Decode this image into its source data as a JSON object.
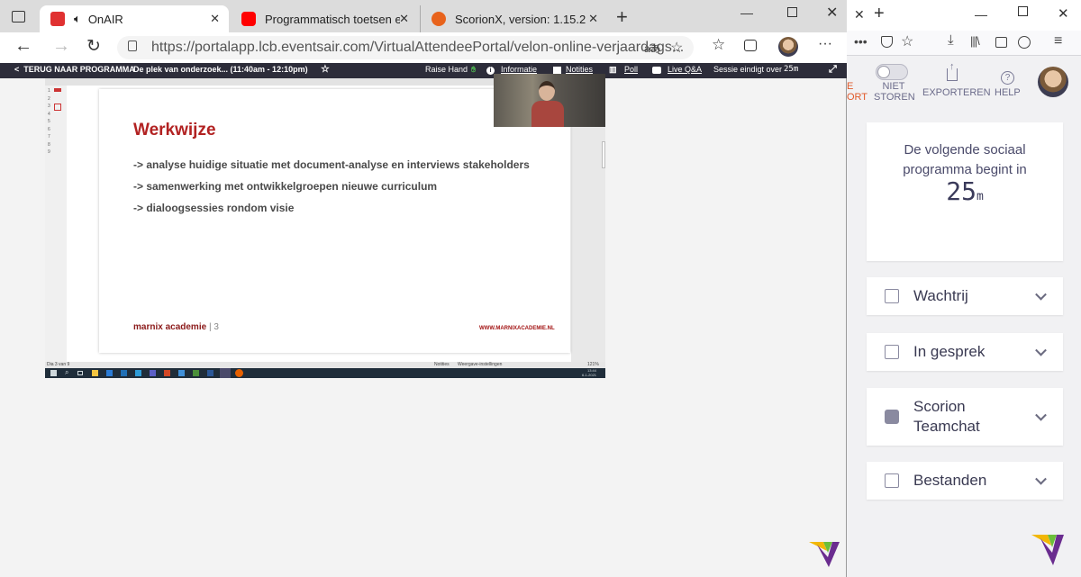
{
  "browser_front": {
    "tabs": [
      {
        "label": "OnAIR",
        "icon": "onair-icon",
        "color": "#e03131"
      },
      {
        "label": "Programmatisch toetsen en feed",
        "icon": "youtube-icon",
        "color": "#ff0000"
      },
      {
        "label": "ScorionX, version: 1.15.2",
        "icon": "scorion-icon",
        "color": "#e8631c"
      }
    ],
    "url": "https://portalapp.lcb.eventsair.com/VirtualAttendeePortal/velon-online-verjaardags..."
  },
  "session_header": {
    "back_label": "TERUG NAAR PROGRAMMA",
    "session_title": "De plek van onderzoek... (11:40am - 12:10pm)",
    "raise_hand": "Raise Hand",
    "informatie": "Informatie",
    "notities": "Notities",
    "poll": "Poll",
    "live_qa": "Live Q&A",
    "ends_label": "Sessie eindigt over",
    "ends_value": "25m"
  },
  "slide": {
    "title": "Werkwijze",
    "bullets": [
      "-> analyse huidige situatie met document-analyse en interviews stakeholders",
      "-> samenwerking met ontwikkelgroepen nieuwe curriculum",
      "-> dialoogsessies rondom visie"
    ],
    "footer_brand": "marnix academie",
    "page_number": "3",
    "footer_url": "WWW.MARNIXACADEMIE.NL",
    "thumb_numbers": [
      "1",
      "2",
      "3",
      "4",
      "5",
      "6",
      "7",
      "8",
      "9"
    ],
    "status_left": "Dia 3 van 9",
    "status_notes": "Notities",
    "status_comments": "Weergave-instellingen",
    "zoom": "121%",
    "clock_time": "13:44",
    "clock_date": "6-1-2021"
  },
  "browser_back": {
    "toolbar_labels": [
      "NIET STOREN",
      "EXPORTEREN",
      "HELP"
    ],
    "partial_label": "E\nORT",
    "countdown": {
      "text": "De volgende sociaal programma begint in",
      "value": "25",
      "unit": "m"
    },
    "panels": [
      "Wachtrij",
      "In gesprek",
      "Scorion Teamchat",
      "Bestanden"
    ]
  },
  "colors": {
    "accent_red": "#b22222",
    "header_dark": "#2d2d3a",
    "logo_yellow": "#f2b705",
    "logo_purple": "#6a2c8f"
  }
}
